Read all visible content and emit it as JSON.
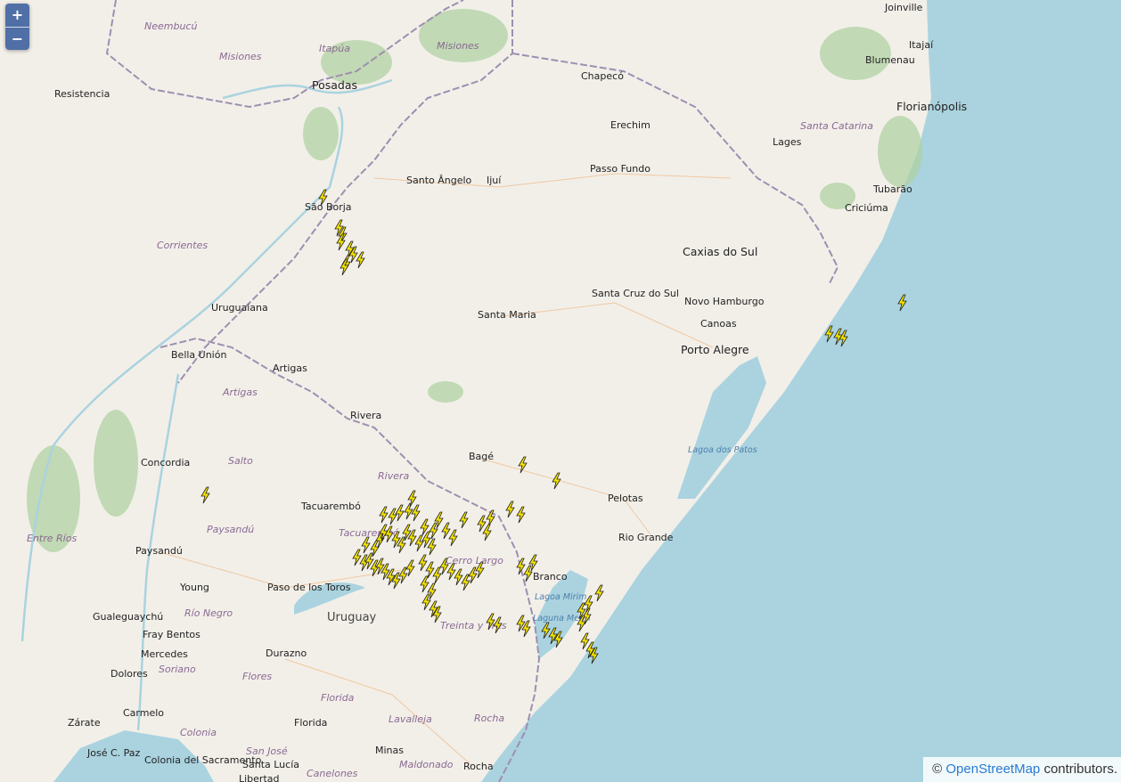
{
  "controls": {
    "zoom_in": "+",
    "zoom_out": "−"
  },
  "attribution": {
    "symbol": "©",
    "link": "OpenStreetMap",
    "suffix": " contributors."
  },
  "colors": {
    "land": "#f2efe9",
    "sea": "#aad3df",
    "forest": "#add19e",
    "border": "#9e8fb0",
    "lightning": "#f5e400"
  },
  "cities": [
    "Joinville",
    "Itajaí",
    "Blumenau",
    "Florianópolis",
    "Chapecó",
    "Erechim",
    "Lages",
    "Tubarão",
    "Criciúma",
    "Passo Fundo",
    "Santo Ângelo",
    "Ijuí",
    "São Borja",
    "Caxias do Sul",
    "Novo Hamburgo",
    "Canoas",
    "Porto Alegre",
    "Santa Cruz do Sul",
    "Santa Maria",
    "Uruguaiana",
    "Bella Unión",
    "Artigas",
    "Rivera",
    "Bagé",
    "Pelotas",
    "Rio Grande",
    "Concordia",
    "Tacuarembó",
    "Paysandú",
    "Young",
    "Paso de los Toros",
    "Gualeguaychú",
    "Fray Bentos",
    "Mercedes",
    "Dolores",
    "Durazno",
    "Zárate",
    "Carmelo",
    "Colonia del Sacramento",
    "José C. Paz",
    "Florida",
    "Minas",
    "Santa Lucía",
    "Libertad",
    "Rocha",
    "Resistencia",
    "Posadas",
    "Branco"
  ],
  "major_labels": [
    "Uruguay"
  ],
  "regions": [
    "Neembucú",
    "Misiones",
    "Itapúa",
    "Misiones",
    "Santa Catarina",
    "Corrientes",
    "Artigas",
    "Salto",
    "Rivera",
    "Entre Ríos",
    "Paysandú",
    "Tacuarembó",
    "Río Negro",
    "Cerro Largo",
    "Treinta y Tres",
    "Soriano",
    "Flores",
    "Florida",
    "Lavalleja",
    "Rocha",
    "Colonia",
    "San José",
    "Maldonado",
    "Canelones"
  ],
  "water_labels": [
    "Lagoa dos Patos",
    "Lagoa Mirim",
    "Laguna Merín"
  ]
}
